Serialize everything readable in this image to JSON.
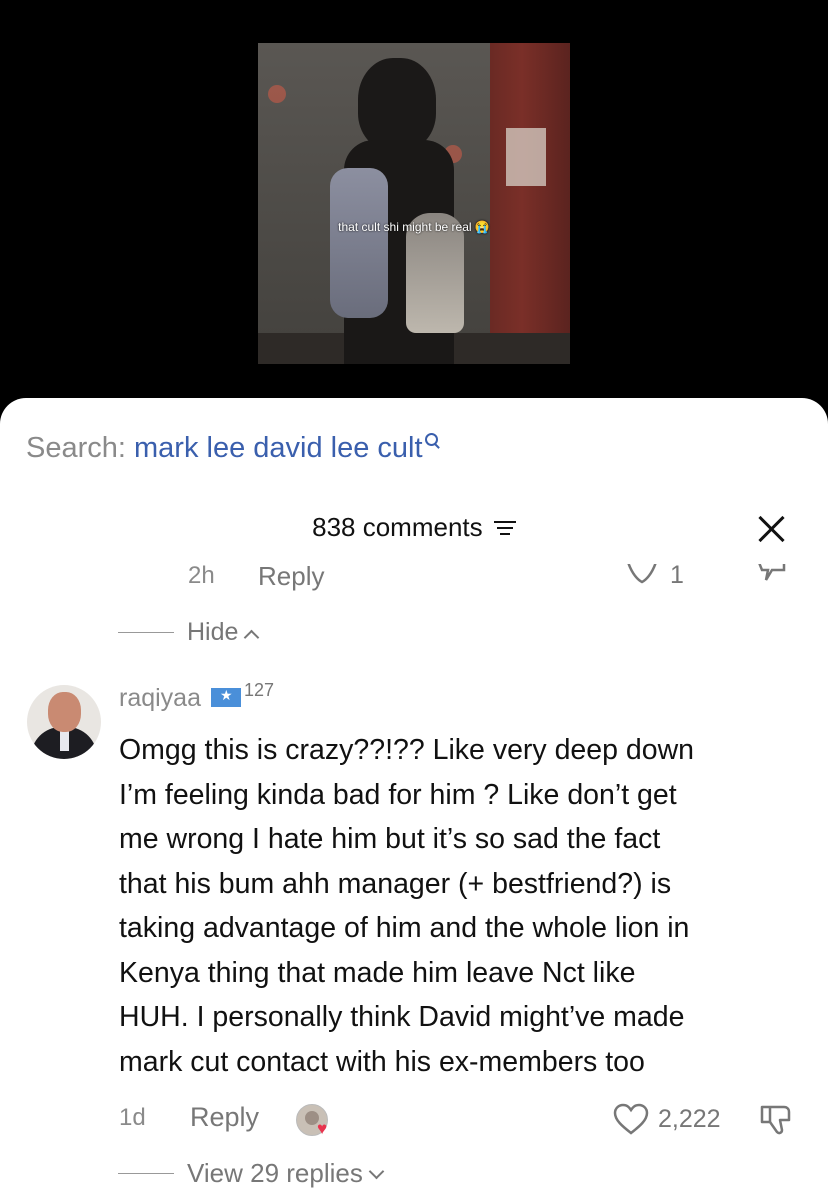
{
  "video": {
    "caption": "that cult shi might be real 😭"
  },
  "search": {
    "label": "Search:",
    "query": "mark lee david lee cult"
  },
  "comments_header": {
    "count_label": "838 comments"
  },
  "previous_comment": {
    "time": "2h",
    "reply_label": "Reply",
    "likes": "1",
    "hide_label": "Hide"
  },
  "comment": {
    "username": "raqiyaa",
    "flag_count": "127",
    "text": "Omgg this is crazy??!?? Like very deep down\nI’m feeling kinda bad for him ? Like don’t get\nme wrong I hate him but it’s so sad the fact\nthat his bum ahh manager (+ bestfriend?) is\ntaking advantage of him and the whole lion in\nKenya thing that made him leave Nct like\nHUH. I personally think David might’ve made\nmark cut contact with his ex-members too",
    "time": "1d",
    "reply_label": "Reply",
    "likes": "2,222",
    "view_replies_label": "View 29 replies"
  },
  "colors": {
    "search_query": "#3a5fad",
    "muted_text": "#8a8a8a",
    "sticker_heart": "#e8344e"
  }
}
